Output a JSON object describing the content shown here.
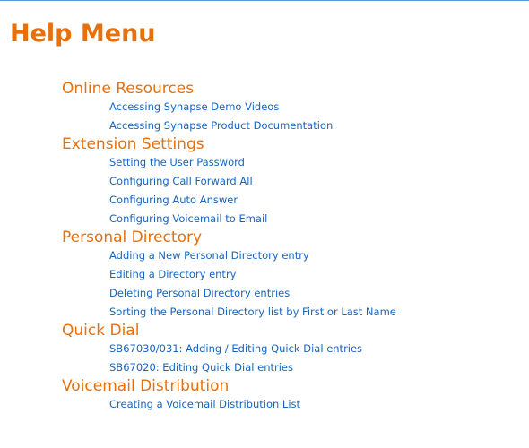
{
  "header": {
    "title": "Help Menu"
  },
  "colors": {
    "heading": "#e8700b",
    "link": "#1565c0",
    "top_rule": "#5b9bd5"
  },
  "sections": [
    {
      "heading": "Online Resources",
      "items": [
        "Accessing Synapse Demo Videos",
        "Accessing Synapse Product Documentation"
      ]
    },
    {
      "heading": "Extension Settings",
      "items": [
        "Setting the User Password",
        "Configuring Call Forward All",
        "Configuring Auto Answer",
        "Configuring Voicemail to Email"
      ]
    },
    {
      "heading": "Personal Directory",
      "items": [
        "Adding a New Personal Directory entry",
        "Editing a Directory entry",
        "Deleting Personal Directory entries",
        "Sorting the Personal Directory list by First or Last Name"
      ]
    },
    {
      "heading": "Quick Dial",
      "items": [
        "SB67030/031: Adding / Editing Quick Dial entries",
        "SB67020: Editing Quick Dial entries"
      ]
    },
    {
      "heading": "Voicemail Distribution",
      "items": [
        "Creating a Voicemail Distribution List"
      ]
    }
  ]
}
